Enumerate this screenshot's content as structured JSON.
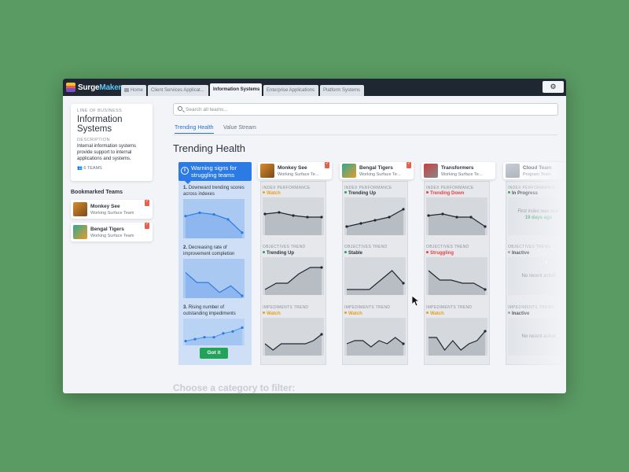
{
  "app": {
    "brand_part1": "Surge",
    "brand_part2": "Maker",
    "colors": {
      "accent": "#2c7be5",
      "success": "#23a35a",
      "warning": "#e8a020",
      "danger": "#e04545",
      "topbar": "#1f2733",
      "background": "#5a9a63"
    }
  },
  "top_tabs": [
    {
      "label": "Home",
      "icon": "home-icon"
    },
    {
      "label": "Client Services Applicat..."
    },
    {
      "label": "Information Systems",
      "active": true
    },
    {
      "label": "Enterprise Applications"
    },
    {
      "label": "Platform Systems"
    }
  ],
  "settings_icon": "gear-icon",
  "lob": {
    "label": "LINE OF BUSINESS",
    "name": "Information Systems",
    "desc_label": "DESCRIPTION",
    "description": "Internal information systems provide support to internal applications and systems.",
    "teams_count": "6 TEAMS"
  },
  "bookmarked": {
    "title": "Bookmarked Teams",
    "items": [
      {
        "name": "Monkey See",
        "sub": "Working Surface Team"
      },
      {
        "name": "Bengal Tigers",
        "sub": "Working Surface Team"
      }
    ]
  },
  "search": {
    "placeholder": "Search all teams..."
  },
  "subtabs": [
    {
      "label": "Trending Health",
      "active": true
    },
    {
      "label": "Value Stream"
    }
  ],
  "section_title": "Trending Health",
  "warning": {
    "title": "Warning signs for struggling teams",
    "steps": [
      {
        "num": "1.",
        "text": "Downward trending scores across indexes"
      },
      {
        "num": "2.",
        "text": "Decreasing rate of improvement completion"
      },
      {
        "num": "3.",
        "text": "Rising number of outstanding impediments"
      }
    ],
    "button": "Got it"
  },
  "teams": [
    {
      "name": "Monkey See",
      "sub": "Working Surface Te...",
      "bookmarked": true,
      "index": {
        "label": "INDEX PERFORMANCE",
        "status": "Watch",
        "kind": "watch",
        "values": [
          6,
          6.5,
          5.5,
          5,
          5
        ]
      },
      "objectives": {
        "label": "OBJECTIVES TREND",
        "status": "Trending Up",
        "kind": "up",
        "values": [
          1,
          3,
          3,
          6,
          8,
          8
        ]
      },
      "impediments": {
        "label": "IMPEDIMENTS TREND",
        "status": "Watch",
        "kind": "watch",
        "values": [
          3,
          1,
          3,
          3,
          3,
          3,
          4,
          6
        ]
      }
    },
    {
      "name": "Bengal Tigers",
      "sub": "Working Surface Te...",
      "bookmarked": true,
      "index": {
        "label": "INDEX PERFORMANCE",
        "status": "Trending Up",
        "kind": "up",
        "values": [
          2,
          3,
          4,
          5,
          7.5
        ]
      },
      "objectives": {
        "label": "OBJECTIVES TREND",
        "status": "Stable",
        "kind": "stable",
        "values": [
          1,
          1,
          1,
          4,
          7,
          3
        ]
      },
      "impediments": {
        "label": "IMPEDIMENTS TREND",
        "status": "Watch",
        "kind": "watch",
        "values": [
          3,
          4,
          4,
          2,
          4,
          3,
          5,
          3
        ]
      }
    },
    {
      "name": "Transformers",
      "sub": "Working Surface Te...",
      "bookmarked": false,
      "index": {
        "label": "INDEX PERFORMANCE",
        "status": "Trending Down",
        "kind": "down",
        "values": [
          5.5,
          6,
          5,
          5,
          2
        ]
      },
      "objectives": {
        "label": "OBJECTIVES TREND",
        "status": "Struggling",
        "kind": "struggling",
        "values": [
          7,
          4,
          4,
          3,
          3,
          1
        ]
      },
      "impediments": {
        "label": "IMPEDIMENTS TREND",
        "status": "Watch",
        "kind": "watch",
        "values": [
          5,
          5,
          1,
          4,
          1,
          3,
          4,
          7
        ]
      }
    },
    {
      "name": "Cloud Team",
      "sub": "Program Team",
      "bookmarked": false,
      "index": {
        "label": "INDEX PERFORMANCE",
        "status": "In Progress",
        "kind": "progress",
        "message": "First index was start",
        "message2": "19 days ago"
      },
      "objectives": {
        "label": "OBJECTIVES TREND",
        "status": "Inactive",
        "kind": "inactive",
        "message": "No recent activit"
      },
      "impediments": {
        "label": "IMPEDIMENTS TREND",
        "status": "Inactive",
        "kind": "inactive",
        "message": "No recent activit"
      }
    }
  ],
  "warning_charts": [
    {
      "values": [
        6,
        7,
        6.5,
        5,
        1
      ]
    },
    {
      "values": [
        7,
        4,
        4,
        1,
        3,
        0
      ]
    },
    {
      "values": [
        1,
        2,
        3,
        3,
        5,
        6,
        8
      ]
    }
  ],
  "filter_title": "Choose a category to filter:"
}
